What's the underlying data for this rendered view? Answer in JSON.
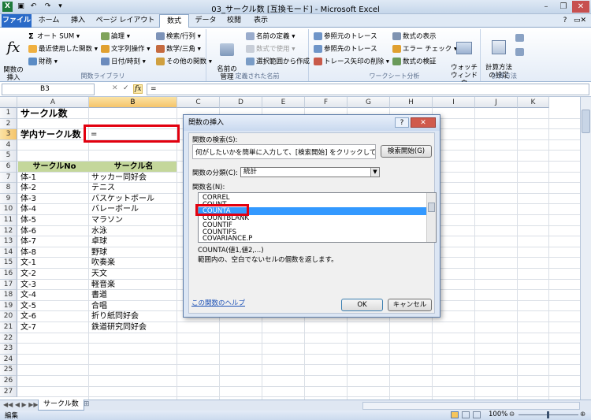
{
  "window": {
    "title": "03_サークル数 [互換モード] - Microsoft Excel"
  },
  "tabs": [
    {
      "label": "ファイル"
    },
    {
      "label": "ホーム"
    },
    {
      "label": "挿入"
    },
    {
      "label": "ページ レイアウト"
    },
    {
      "label": "数式"
    },
    {
      "label": "データ"
    },
    {
      "label": "校閲"
    },
    {
      "label": "表示"
    }
  ],
  "active_tab": "数式",
  "ribbon": {
    "insert_function": "関数の\n挿入",
    "autosum": "オート SUM",
    "recent": "最近使用した関数",
    "financial": "財務",
    "logical": "論理",
    "text": "文字列操作",
    "datetime": "日付/時刻",
    "lookup": "検索/行列",
    "math": "数学/三角",
    "more": "その他の関数",
    "group_library": "関数ライブラリ",
    "name_manager": "名前の\n管理",
    "define_name": "名前の定義",
    "use_in_formula": "数式で使用",
    "create_from_selection": "選択範囲から作成",
    "group_names": "定義された名前",
    "trace_precedents": "参照元のトレース",
    "trace_dependents": "参照先のトレース",
    "remove_arrows": "トレース矢印の削除",
    "show_formulas": "数式の表示",
    "error_checking": "エラー チェック",
    "evaluate_formula": "数式の検証",
    "watch_window": "ウォッチ\nウィンドウ",
    "group_audit": "ワークシート分析",
    "calc_options": "計算方法\nの設定",
    "group_calc": "計算方法"
  },
  "formula_bar": {
    "name_box": "B3",
    "formula": "="
  },
  "columns": [
    "A",
    "B",
    "C",
    "D",
    "E",
    "F",
    "G",
    "H",
    "I",
    "J",
    "K"
  ],
  "rows": [
    "1",
    "2",
    "3",
    "4",
    "5",
    "6",
    "7",
    "8",
    "9",
    "10",
    "11",
    "12",
    "13",
    "14",
    "15",
    "16",
    "17",
    "18",
    "19",
    "20",
    "21",
    "22",
    "23",
    "24",
    "25",
    "26",
    "27"
  ],
  "sheet": {
    "title": "サークル数",
    "label_count": "学内サークル数",
    "active_value": "=",
    "header_no": "サークルNo",
    "header_name": "サークル名",
    "records": [
      {
        "no": "体-1",
        "name": "サッカー同好会"
      },
      {
        "no": "体-2",
        "name": "テニス"
      },
      {
        "no": "体-3",
        "name": "バスケットボール"
      },
      {
        "no": "体-4",
        "name": "バレーボール"
      },
      {
        "no": "体-5",
        "name": "マラソン"
      },
      {
        "no": "体-6",
        "name": "水泳"
      },
      {
        "no": "体-7",
        "name": "卓球"
      },
      {
        "no": "体-8",
        "name": "野球"
      },
      {
        "no": "文-1",
        "name": "吹奏楽"
      },
      {
        "no": "文-2",
        "name": "天文"
      },
      {
        "no": "文-3",
        "name": "軽音楽"
      },
      {
        "no": "文-4",
        "name": "書道"
      },
      {
        "no": "文-5",
        "name": "合唱"
      },
      {
        "no": "文-6",
        "name": "折り紙同好会"
      },
      {
        "no": "文-7",
        "name": "鉄道研究同好会"
      }
    ]
  },
  "sheet_tab": "サークル数",
  "status": {
    "mode": "編集",
    "zoom": "100%"
  },
  "dialog": {
    "title": "関数の挿入",
    "search_label": "関数の検索(S):",
    "search_text": "何がしたいかを簡単に入力して、[検索開始] をクリックしてください。",
    "search_button": "検索開始(G)",
    "category_label": "関数の分類(C):",
    "category_value": "統計",
    "list_label": "関数名(N):",
    "functions": [
      "CORREL",
      "COUNT",
      "COUNTA",
      "COUNTBLANK",
      "COUNTIF",
      "COUNTIFS",
      "COVARIANCE.P"
    ],
    "selected": "COUNTA",
    "syntax": "COUNTA(値1,値2,...)",
    "description": "範囲内の、空白でないセルの個数を返します。",
    "help_link": "この関数のヘルプ",
    "ok": "OK",
    "cancel": "キャンセル"
  }
}
